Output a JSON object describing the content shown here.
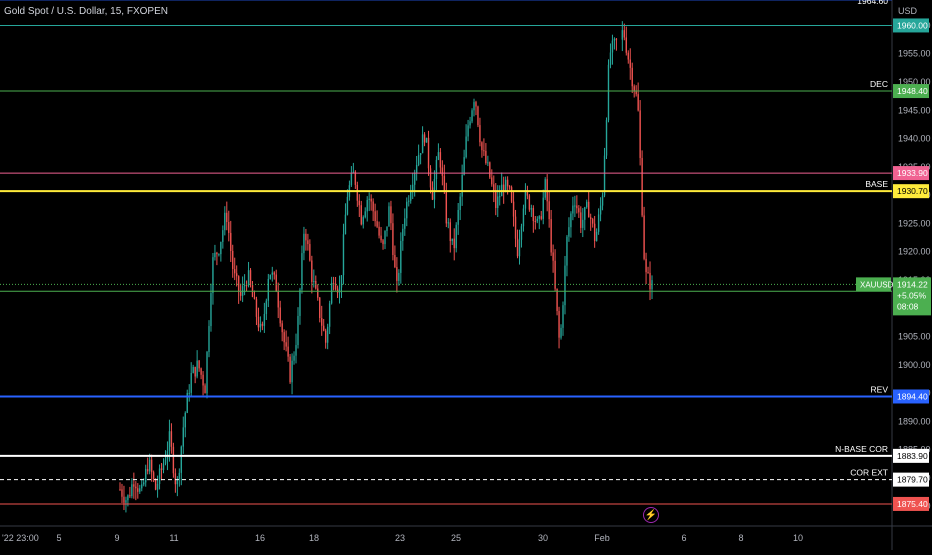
{
  "header": {
    "symbol_title": "Gold Spot / U.S. Dollar, 15, FXOPEN"
  },
  "axis": {
    "currency_label": "USD",
    "partial_left_label": "'22  23:00"
  },
  "chart_data": {
    "type": "candlestick",
    "title": "Gold Spot / U.S. Dollar, 15, FXOPEN",
    "ylim": [
      1871.5,
      1964.5
    ],
    "y_ticks": [
      "1875.00",
      "1880.00",
      "1885.00",
      "1890.00",
      "1895.00",
      "1900.00",
      "1905.00",
      "1910.00",
      "1915.00",
      "1920.00",
      "1925.00",
      "1930.00",
      "1935.00",
      "1940.00",
      "1945.00",
      "1950.00",
      "1955.00",
      "1960.00"
    ],
    "x_ticks": [
      "5",
      "9",
      "11",
      "16",
      "18",
      "23",
      "25",
      "30",
      "Feb",
      "6",
      "8",
      "10"
    ],
    "price_path": [
      1878,
      1876,
      1880,
      1877,
      1883,
      1878,
      1882,
      1887,
      1878,
      1890,
      1898,
      1900,
      1896,
      1918,
      1921,
      1927,
      1916,
      1912,
      1916,
      1910,
      1905,
      1917,
      1914,
      1905,
      1898,
      1906,
      1925,
      1916,
      1910,
      1904,
      1916,
      1913,
      1930,
      1934,
      1926,
      1930,
      1926,
      1920,
      1928,
      1913,
      1926,
      1932,
      1937,
      1941,
      1930,
      1938,
      1926,
      1920,
      1930,
      1942,
      1948,
      1938,
      1934,
      1928,
      1932,
      1930,
      1920,
      1930,
      1928,
      1924,
      1932,
      1918,
      1903,
      1922,
      1930,
      1925,
      1928,
      1922,
      1930,
      1955,
      1957,
      1959,
      1952,
      1946,
      1916,
      1914
    ],
    "horizontal_levels": [
      {
        "label": "REV",
        "price": "1964.60",
        "color": "#2962ff"
      },
      {
        "label": "",
        "price": "1960.00",
        "color": "#26a69a"
      },
      {
        "label": "DEC",
        "price": "1948.40",
        "color": "#4caf50"
      },
      {
        "label": "",
        "price": "1933.90",
        "color": "#f06292"
      },
      {
        "label": "BASE",
        "price": "1930.70",
        "color": "#ffeb3b"
      },
      {
        "label": "",
        "price": "1913.00",
        "color": "#4caf50"
      },
      {
        "label": "REV",
        "price": "1894.40",
        "color": "#2962ff"
      },
      {
        "label": "N-BASE COR",
        "price": "1883.90",
        "color": "#ffffff"
      },
      {
        "label": "COR EXT",
        "price": "1879.70",
        "color": "#ffffff"
      },
      {
        "label": "",
        "price": "1875.40",
        "color": "#ef5350"
      }
    ],
    "current_price": {
      "symbol": "XAUUSD",
      "price": "1914.22",
      "change": "+5.05%",
      "countdown": "08:08",
      "color": "#4caf50"
    }
  }
}
